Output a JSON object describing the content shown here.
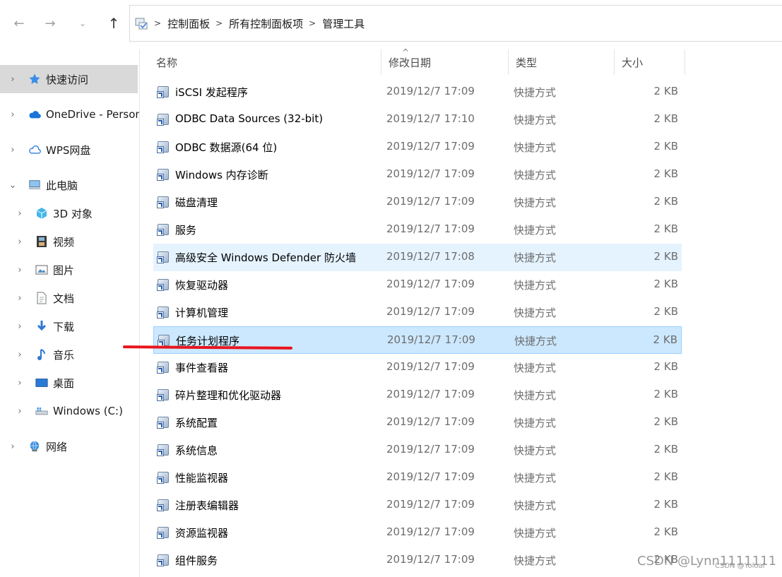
{
  "toolbar": {
    "back_icon": "←",
    "forward_icon": "→",
    "recent_icon": "⌄",
    "up_icon": "↑"
  },
  "breadcrumb": [
    "控制面板",
    "所有控制面板项",
    "管理工具"
  ],
  "sidebar": {
    "items": [
      {
        "label": "快速访问",
        "icon": "star-icon",
        "chevron": "›",
        "level": 0,
        "selected": true
      },
      {
        "label": "OneDrive - Person",
        "icon": "cloud-icon",
        "chevron": "›",
        "level": 0
      },
      {
        "label": "WPS网盘",
        "icon": "cloud-outline-icon",
        "chevron": "›",
        "level": 0
      },
      {
        "label": "此电脑",
        "icon": "computer-icon",
        "chevron": "⌄",
        "level": 0
      },
      {
        "label": "3D 对象",
        "icon": "cube-icon",
        "chevron": "›",
        "level": 1
      },
      {
        "label": "视频",
        "icon": "film-icon",
        "chevron": "›",
        "level": 1
      },
      {
        "label": "图片",
        "icon": "picture-icon",
        "chevron": "›",
        "level": 1
      },
      {
        "label": "文档",
        "icon": "document-icon",
        "chevron": "›",
        "level": 1
      },
      {
        "label": "下载",
        "icon": "download-icon",
        "chevron": "›",
        "level": 1
      },
      {
        "label": "音乐",
        "icon": "music-icon",
        "chevron": "›",
        "level": 1
      },
      {
        "label": "桌面",
        "icon": "desktop-icon",
        "chevron": "›",
        "level": 1
      },
      {
        "label": "Windows (C:)",
        "icon": "drive-icon",
        "chevron": "›",
        "level": 1
      },
      {
        "label": "网络",
        "icon": "network-icon",
        "chevron": "›",
        "level": 0
      }
    ]
  },
  "columns": {
    "name": "名称",
    "date": "修改日期",
    "type": "类型",
    "size": "大小",
    "sort_indicator": "^"
  },
  "files": [
    {
      "name": "iSCSI 发起程序",
      "date": "2019/12/7 17:09",
      "type": "快捷方式",
      "size": "2 KB",
      "icon": "iscsi-icon"
    },
    {
      "name": "ODBC Data Sources (32-bit)",
      "date": "2019/12/7 17:10",
      "type": "快捷方式",
      "size": "2 KB",
      "icon": "odbc-icon"
    },
    {
      "name": "ODBC 数据源(64 位)",
      "date": "2019/12/7 17:09",
      "type": "快捷方式",
      "size": "2 KB",
      "icon": "odbc-icon"
    },
    {
      "name": "Windows 内存诊断",
      "date": "2019/12/7 17:09",
      "type": "快捷方式",
      "size": "2 KB",
      "icon": "memory-diagnostic-icon"
    },
    {
      "name": "磁盘清理",
      "date": "2019/12/7 17:09",
      "type": "快捷方式",
      "size": "2 KB",
      "icon": "disk-cleanup-icon"
    },
    {
      "name": "服务",
      "date": "2019/12/7 17:09",
      "type": "快捷方式",
      "size": "2 KB",
      "icon": "services-icon"
    },
    {
      "name": "高级安全 Windows Defender 防火墙",
      "date": "2019/12/7 17:08",
      "type": "快捷方式",
      "size": "2 KB",
      "icon": "firewall-icon",
      "state": "hover"
    },
    {
      "name": "恢复驱动器",
      "date": "2019/12/7 17:09",
      "type": "快捷方式",
      "size": "2 KB",
      "icon": "recovery-drive-icon"
    },
    {
      "name": "计算机管理",
      "date": "2019/12/7 17:09",
      "type": "快捷方式",
      "size": "2 KB",
      "icon": "computer-management-icon"
    },
    {
      "name": "任务计划程序",
      "date": "2019/12/7 17:09",
      "type": "快捷方式",
      "size": "2 KB",
      "icon": "task-scheduler-icon",
      "state": "selected"
    },
    {
      "name": "事件查看器",
      "date": "2019/12/7 17:09",
      "type": "快捷方式",
      "size": "2 KB",
      "icon": "event-viewer-icon"
    },
    {
      "name": "碎片整理和优化驱动器",
      "date": "2019/12/7 17:09",
      "type": "快捷方式",
      "size": "2 KB",
      "icon": "defrag-icon"
    },
    {
      "name": "系统配置",
      "date": "2019/12/7 17:09",
      "type": "快捷方式",
      "size": "2 KB",
      "icon": "system-config-icon"
    },
    {
      "name": "系统信息",
      "date": "2019/12/7 17:09",
      "type": "快捷方式",
      "size": "2 KB",
      "icon": "system-info-icon"
    },
    {
      "name": "性能监视器",
      "date": "2019/12/7 17:09",
      "type": "快捷方式",
      "size": "2 KB",
      "icon": "performance-monitor-icon"
    },
    {
      "name": "注册表编辑器",
      "date": "2019/12/7 17:09",
      "type": "快捷方式",
      "size": "2 KB",
      "icon": "registry-editor-icon"
    },
    {
      "name": "资源监视器",
      "date": "2019/12/7 17:09",
      "type": "快捷方式",
      "size": "2 KB",
      "icon": "resource-monitor-icon"
    },
    {
      "name": "组件服务",
      "date": "2019/12/7 17:09",
      "type": "快捷方式",
      "size": "2 KB",
      "icon": "component-services-icon"
    }
  ],
  "watermark": {
    "main": "CSDN @Lynn1111111",
    "small": "CSDN @Yoloal"
  },
  "colors": {
    "selected_row": "#cce8ff",
    "hover_row": "#e5f3ff",
    "sidebar_selected": "#d9d9d9",
    "annotation_line": "#e8151e"
  }
}
